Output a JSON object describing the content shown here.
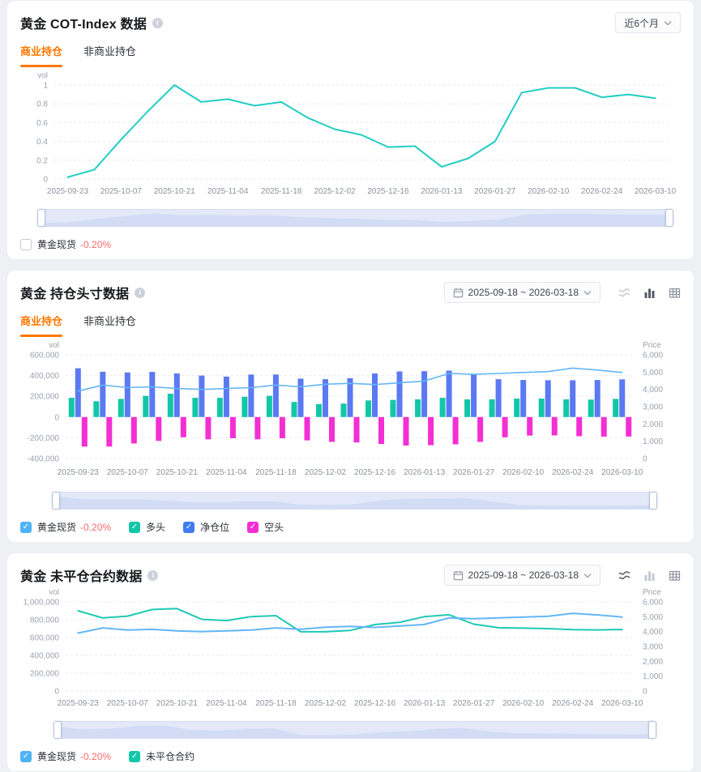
{
  "accent": {
    "tab_active": "#ff7700",
    "negative_pct": "#f56a6a",
    "cot_line": "#22cdc4",
    "long_bar": "#12c7a7",
    "net_bar": "#5b79f2",
    "short_bar": "#f32fd3",
    "price_line": "#63b6f6",
    "oi_line": "#1fc9b6"
  },
  "panels": [
    {
      "title": "黄金 COT-Index 数据",
      "range_label": "近6个月",
      "tabs": [
        {
          "label": "商业持仓",
          "active": true
        },
        {
          "label": "非商业持仓",
          "active": false
        }
      ],
      "legend": [
        {
          "label": "黄金现货",
          "pct": "-0.20%",
          "checked": false,
          "color": "#4fb3f6"
        }
      ]
    },
    {
      "title": "黄金 持仓头寸数据",
      "date_range": "2025-09-18 ~ 2026-03-18",
      "tabs": [
        {
          "label": "商业持仓",
          "active": true
        },
        {
          "label": "非商业持仓",
          "active": false
        }
      ],
      "toolbar": {
        "icons": [
          {
            "name": "line-chart",
            "state": "inactive"
          },
          {
            "name": "bar-chart",
            "state": "active"
          },
          {
            "name": "table",
            "state": "mid"
          }
        ]
      },
      "legend": [
        {
          "label": "黄金现货",
          "pct": "-0.20%",
          "checked": true,
          "color": "#4fb3f6"
        },
        {
          "label": "多头",
          "checked": true,
          "color": "#12c7a7"
        },
        {
          "label": "净仓位",
          "checked": true,
          "color": "#3f7bf4"
        },
        {
          "label": "空头",
          "checked": true,
          "color": "#f32fd3"
        }
      ]
    },
    {
      "title": "黄金 未平仓合约数据",
      "date_range": "2025-09-18 ~ 2026-03-18",
      "toolbar": {
        "icons": [
          {
            "name": "line-chart",
            "state": "active"
          },
          {
            "name": "bar-chart",
            "state": "inactive"
          },
          {
            "name": "table",
            "state": "mid"
          }
        ]
      },
      "legend": [
        {
          "label": "黄金现货",
          "pct": "-0.20%",
          "checked": true,
          "color": "#4fb3f6"
        },
        {
          "label": "未平仓合约",
          "checked": true,
          "color": "#12c7a7"
        }
      ]
    }
  ],
  "chart_data": [
    {
      "type": "line",
      "title": "黄金 COT-Index 数据 (商业持仓)",
      "x": [
        "2025-09-23",
        "2025-09-30",
        "2025-10-07",
        "2025-10-14",
        "2025-10-21",
        "2025-10-28",
        "2025-11-04",
        "2025-11-11",
        "2025-11-18",
        "2025-11-25",
        "2025-12-02",
        "2025-12-09",
        "2025-12-16",
        "2025-12-23",
        "2026-01-13",
        "2026-01-20",
        "2026-01-27",
        "2026-02-03",
        "2026-02-10",
        "2026-02-17",
        "2026-02-24",
        "2026-03-03",
        "2026-03-10"
      ],
      "label_every": 2,
      "left": {
        "title": "vol",
        "min": 0,
        "max": 1,
        "ticks": [
          1,
          0.8,
          0.6,
          0.4,
          0.2,
          0
        ]
      },
      "lines": [
        {
          "name": "COT-Index",
          "axis": "left",
          "color": "#22cdc4",
          "width": 2,
          "values": [
            0.02,
            0.1,
            0.42,
            0.72,
            1.0,
            0.82,
            0.85,
            0.78,
            0.82,
            0.65,
            0.53,
            0.47,
            0.34,
            0.35,
            0.13,
            0.22,
            0.4,
            0.92,
            0.97,
            0.97,
            0.87,
            0.9,
            0.86
          ]
        }
      ]
    },
    {
      "type": "bar",
      "title": "黄金 持仓头寸数据 (商业持仓)",
      "x": [
        "2025-09-23",
        "2025-09-30",
        "2025-10-07",
        "2025-10-14",
        "2025-10-21",
        "2025-10-28",
        "2025-11-04",
        "2025-11-11",
        "2025-11-18",
        "2025-11-25",
        "2025-12-02",
        "2025-12-09",
        "2025-12-16",
        "2025-12-23",
        "2026-01-13",
        "2026-01-20",
        "2026-01-27",
        "2026-02-03",
        "2026-02-10",
        "2026-02-17",
        "2026-02-24",
        "2026-03-03",
        "2026-03-10"
      ],
      "label_every": 2,
      "left": {
        "title": "vol",
        "min": -400000,
        "max": 600000,
        "ticks": [
          600000,
          400000,
          200000,
          0,
          -200000,
          -400000
        ]
      },
      "right": {
        "title": "Price",
        "min": 0,
        "max": 6000,
        "ticks": [
          6000,
          5000,
          4000,
          3000,
          2000,
          1000,
          0
        ]
      },
      "bars": [
        {
          "name": "多头",
          "color": "#12c7a7",
          "values": [
            185000,
            152000,
            175000,
            205000,
            225000,
            185000,
            185000,
            195000,
            205000,
            145000,
            125000,
            130000,
            160000,
            165000,
            170000,
            185000,
            170000,
            170000,
            178000,
            178000,
            170000,
            168000,
            175000
          ]
        },
        {
          "name": "净仓位",
          "color": "#5b79f2",
          "values": [
            470000,
            437000,
            430000,
            435000,
            420000,
            400000,
            390000,
            410000,
            410000,
            370000,
            365000,
            375000,
            420000,
            440000,
            442000,
            448000,
            410000,
            365000,
            357000,
            355000,
            355000,
            357000,
            363000
          ]
        },
        {
          "name": "空头",
          "color": "#f32fd3",
          "values": [
            -285000,
            -285000,
            -255000,
            -230000,
            -195000,
            -215000,
            -205000,
            -215000,
            -205000,
            -225000,
            -240000,
            -245000,
            -260000,
            -275000,
            -272000,
            -263000,
            -240000,
            -195000,
            -179000,
            -177000,
            -185000,
            -189000,
            -188000
          ]
        }
      ],
      "lines": [
        {
          "name": "黄金现货",
          "axis": "right",
          "color": "#63b6f6",
          "width": 1.6,
          "values": [
            3900,
            4250,
            4100,
            4150,
            4050,
            4000,
            4050,
            4100,
            4250,
            4150,
            4300,
            4350,
            4280,
            4380,
            4480,
            4920,
            4870,
            4920,
            4980,
            5030,
            5230,
            5120,
            4980
          ]
        }
      ]
    },
    {
      "type": "line",
      "title": "黄金 未平仓合约数据",
      "x": [
        "2025-09-23",
        "2025-09-30",
        "2025-10-07",
        "2025-10-14",
        "2025-10-21",
        "2025-10-28",
        "2025-11-04",
        "2025-11-11",
        "2025-11-18",
        "2025-11-25",
        "2025-12-02",
        "2025-12-09",
        "2025-12-16",
        "2025-12-23",
        "2026-01-13",
        "2026-01-20",
        "2026-01-27",
        "2026-02-03",
        "2026-02-10",
        "2026-02-17",
        "2026-02-24",
        "2026-03-03",
        "2026-03-10"
      ],
      "label_every": 2,
      "left": {
        "title": "vol",
        "min": 0,
        "max": 1000000,
        "ticks": [
          1000000,
          800000,
          600000,
          400000,
          200000,
          0
        ]
      },
      "right": {
        "title": "Price",
        "min": 0,
        "max": 6000,
        "ticks": [
          6000,
          5000,
          4000,
          3000,
          2000,
          1000,
          0
        ]
      },
      "lines": [
        {
          "name": "未平仓合约",
          "axis": "left",
          "color": "#1fc9b6",
          "width": 2,
          "values": [
            900000,
            820000,
            840000,
            915000,
            925000,
            805000,
            790000,
            835000,
            845000,
            665000,
            665000,
            680000,
            745000,
            770000,
            835000,
            855000,
            750000,
            710000,
            705000,
            700000,
            688000,
            685000,
            690000
          ]
        },
        {
          "name": "黄金现货",
          "axis": "right",
          "color": "#63b6f6",
          "width": 2,
          "values": [
            3900,
            4250,
            4100,
            4150,
            4050,
            4000,
            4050,
            4100,
            4250,
            4150,
            4300,
            4350,
            4280,
            4380,
            4480,
            4920,
            4870,
            4920,
            4980,
            5030,
            5230,
            5120,
            4980
          ]
        }
      ]
    }
  ]
}
